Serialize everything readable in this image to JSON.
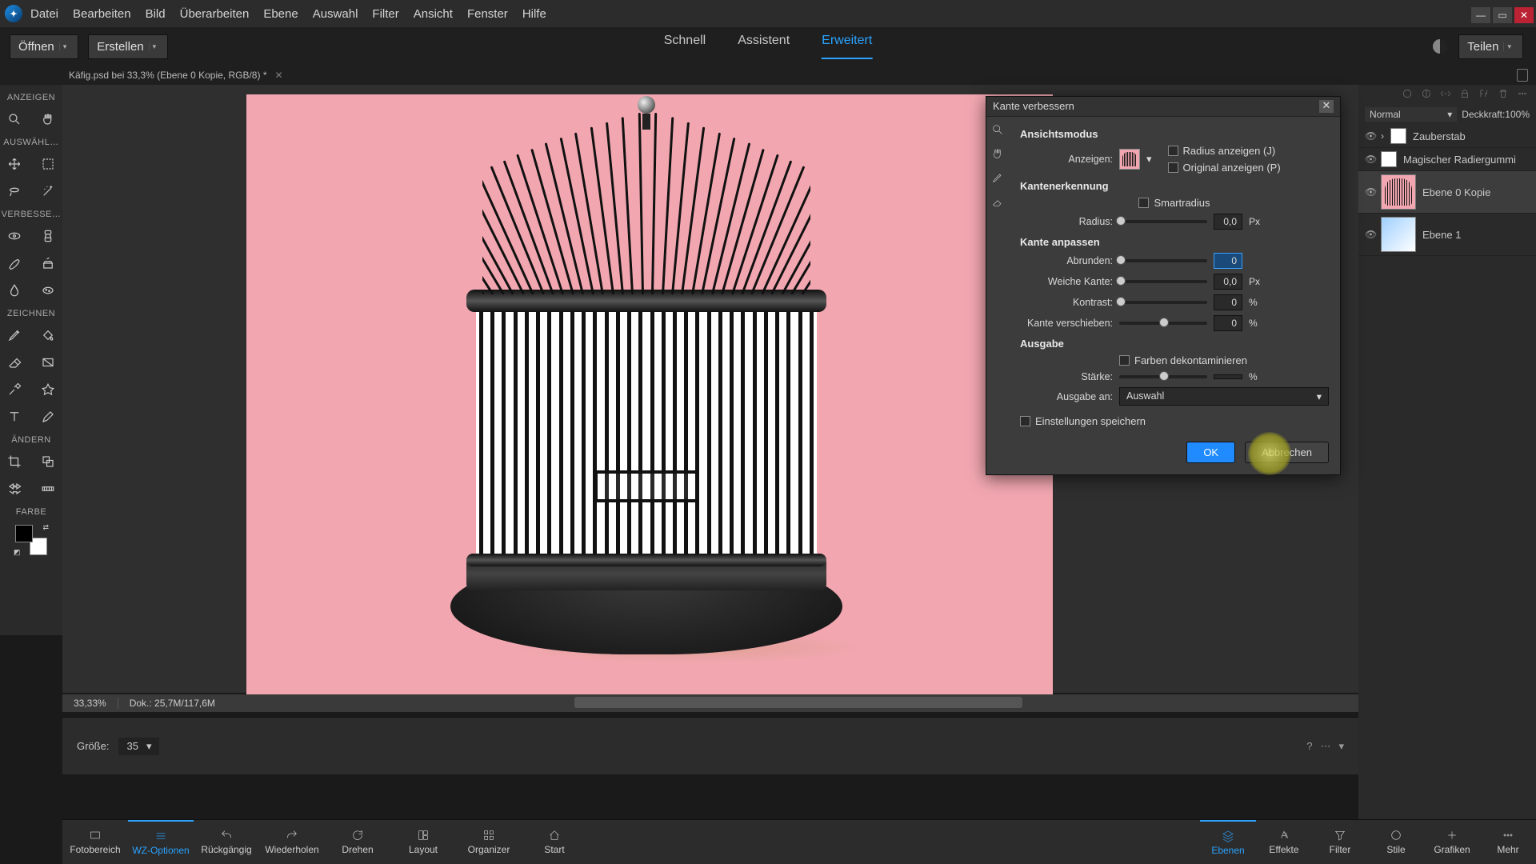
{
  "menu": [
    "Datei",
    "Bearbeiten",
    "Bild",
    "Überarbeiten",
    "Ebene",
    "Auswahl",
    "Filter",
    "Ansicht",
    "Fenster",
    "Hilfe"
  ],
  "secondbar": {
    "open": "Öffnen",
    "create": "Erstellen",
    "share": "Teilen"
  },
  "tabs": {
    "quick": "Schnell",
    "assist": "Assistent",
    "adv": "Erweitert"
  },
  "doctab": {
    "title": "Käfig.psd bei 33,3% (Ebene 0 Kopie, RGB/8) *"
  },
  "tool_groups": {
    "show": "ANZEIGEN",
    "select": "AUSWÄHL…",
    "enhance": "VERBESSE…",
    "draw": "ZEICHNEN",
    "modify": "ÄNDERN",
    "color": "FARBE"
  },
  "status": {
    "zoom": "33,33%",
    "doc": "Dok.: 25,7M/117,6M"
  },
  "options": {
    "size_label": "Größe:",
    "size_value": "35"
  },
  "layers": {
    "blend": "Normal",
    "opacity_label": "Deckkraft:",
    "opacity": "100%",
    "items": [
      {
        "name": "Zauberstab"
      },
      {
        "name": "Magischer Radiergummi"
      },
      {
        "name": "Ebene 0 Kopie"
      },
      {
        "name": "Ebene 1"
      }
    ]
  },
  "dialog": {
    "title": "Kante verbessern",
    "view_mode": "Ansichtsmodus",
    "show_label": "Anzeigen:",
    "radius_show": "Radius anzeigen (J)",
    "orig_show": "Original anzeigen (P)",
    "edge_detect": "Kantenerkennung",
    "smart_radius": "Smartradius",
    "radius_label": "Radius:",
    "radius_val": "0,0",
    "px": "Px",
    "adjust": "Kante anpassen",
    "smooth_label": "Abrunden:",
    "smooth_val": "0",
    "feather_label": "Weiche Kante:",
    "feather_val": "0,0",
    "contrast_label": "Kontrast:",
    "contrast_val": "0",
    "pct": "%",
    "shift_label": "Kante verschieben:",
    "shift_val": "0",
    "output": "Ausgabe",
    "decon": "Farben dekontaminieren",
    "amount_label": "Stärke:",
    "output_to": "Ausgabe an:",
    "output_sel": "Auswahl",
    "remember": "Einstellungen speichern",
    "ok": "OK",
    "cancel": "Abbrechen"
  },
  "bottom": {
    "left": [
      "Fotobereich",
      "WZ-Optionen",
      "Rückgängig",
      "Wiederholen",
      "Drehen",
      "Layout",
      "Organizer",
      "Start"
    ],
    "right": [
      "Ebenen",
      "Effekte",
      "Filter",
      "Stile",
      "Grafiken",
      "Mehr"
    ]
  }
}
